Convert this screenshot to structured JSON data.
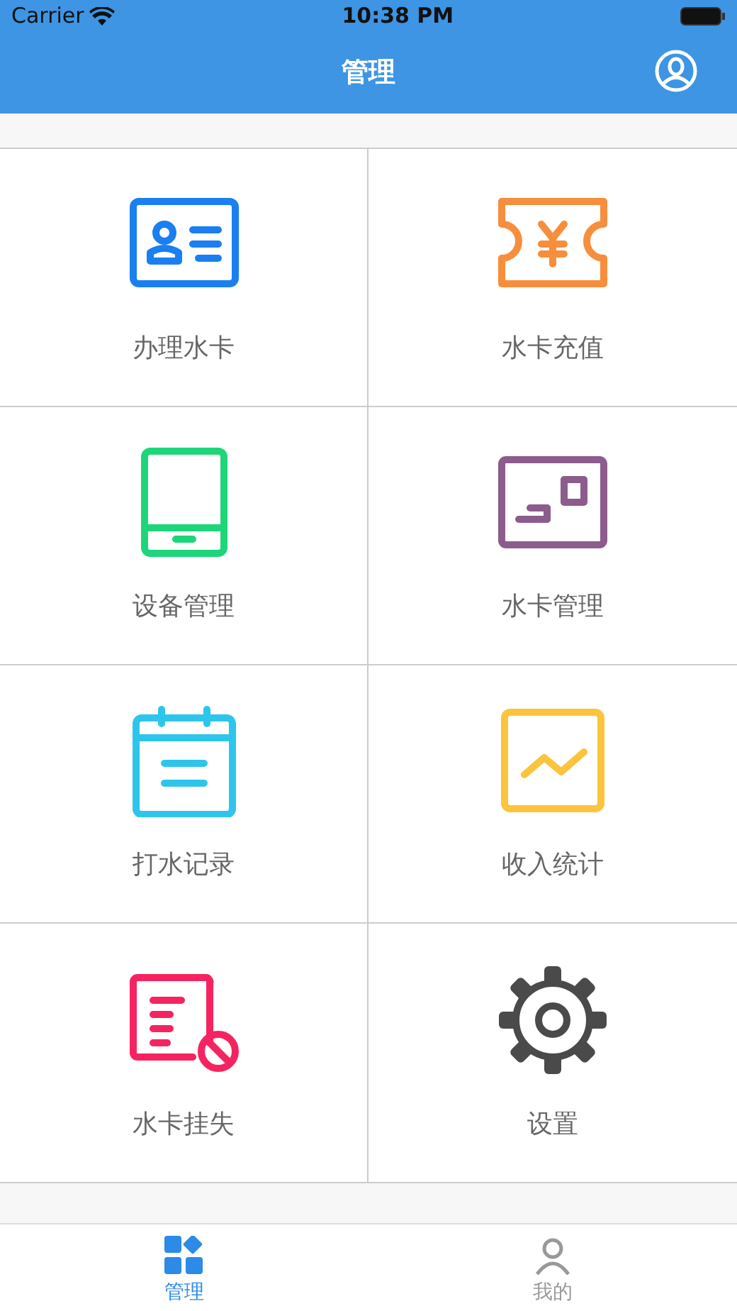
{
  "status_bar": {
    "carrier": "Carrier",
    "time": "10:38 PM"
  },
  "nav_bar": {
    "title": "管理"
  },
  "grid": [
    {
      "label": "办理水卡",
      "kind": "id-card",
      "color": "#1a7ff0"
    },
    {
      "label": "水卡充值",
      "kind": "ticket",
      "color": "#f78e3d"
    },
    {
      "label": "设备管理",
      "kind": "tablet",
      "color": "#1ed67a"
    },
    {
      "label": "水卡管理",
      "kind": "card",
      "color": "#8c5c8c"
    },
    {
      "label": "打水记录",
      "kind": "calendar",
      "color": "#2ec5ec"
    },
    {
      "label": "收入统计",
      "kind": "chart",
      "color": "#fcc43c"
    },
    {
      "label": "水卡挂失",
      "kind": "lost-card",
      "color": "#f52461"
    },
    {
      "label": "设置",
      "kind": "gear",
      "color": "#4a4a4a"
    }
  ],
  "tab_bar": [
    {
      "label": "管理",
      "kind": "grid",
      "selected": true
    },
    {
      "label": "我的",
      "kind": "person",
      "selected": false
    }
  ]
}
